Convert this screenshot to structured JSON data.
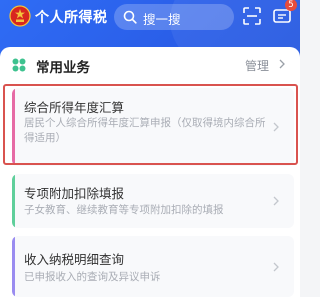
{
  "header": {
    "app_name": "个人所得税",
    "search_placeholder": "搜一搜",
    "message_badge": "5"
  },
  "section": {
    "title": "常用业务",
    "manage_label": "管理"
  },
  "services": {
    "items": [
      {
        "title": "综合所得年度汇算",
        "desc": "居民个人综合所得年度汇算申报（仅取得境内综合所得适用）",
        "accent": "#e66ba5"
      },
      {
        "title": "专项附加扣除填报",
        "desc": "子女教育、继续教育等专项附加扣除的填报",
        "accent": "#5fcf9b"
      },
      {
        "title": "收入纳税明细查询",
        "desc": "已申报收入的查询及异议申诉",
        "accent": "#9a8cf0"
      }
    ]
  },
  "colors": {
    "header_blue": "#2f6cf5",
    "highlight_red": "#d9534f"
  },
  "icons": [
    "national-emblem-icon",
    "search-icon",
    "scan-icon",
    "message-icon",
    "grid-icon",
    "chevron-right-icon"
  ]
}
